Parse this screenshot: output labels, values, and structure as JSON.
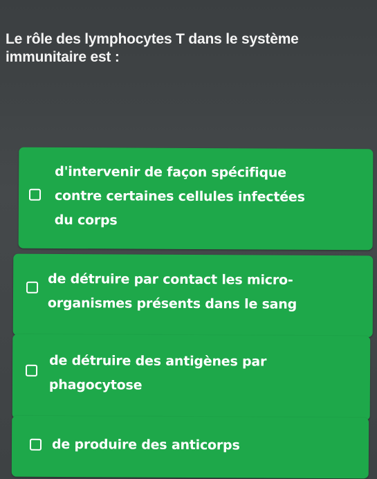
{
  "question": {
    "lines": [
      "Le rôle des  lymphocytes T dans le système",
      "immunitaire est :"
    ]
  },
  "options": [
    {
      "lines": [
        "d'intervenir de façon spécifique",
        "contre certaines cellules infectées",
        "du corps"
      ]
    },
    {
      "lines": [
        "de détruire par contact les micro-",
        "organismes présents dans le sang"
      ]
    },
    {
      "lines": [
        "de détruire des antigènes par",
        "phagocytose"
      ]
    },
    {
      "lines": [
        "de produire des anticorps"
      ]
    }
  ],
  "colors": {
    "background": "#3f4345",
    "option_fill": "#1ea84a",
    "text": "#ffffff"
  }
}
